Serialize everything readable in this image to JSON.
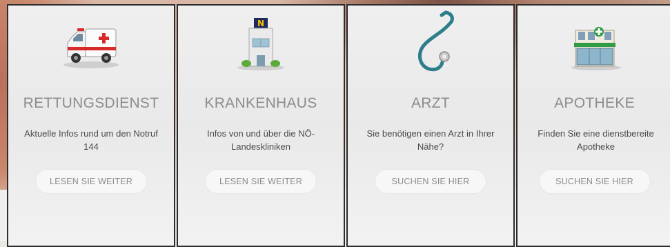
{
  "cards": [
    {
      "icon": "ambulance-icon",
      "title": "RETTUNGSDIENST",
      "description": "Aktuelle Infos rund um den Notruf 144",
      "button": "LESEN SIE WEITER"
    },
    {
      "icon": "hospital-icon",
      "title": "KRANKENHAUS",
      "description": "Infos von und über die NÖ-Landeskliniken",
      "button": "LESEN SIE WEITER"
    },
    {
      "icon": "stethoscope-icon",
      "title": "ARZT",
      "description": "Sie benötigen einen Arzt in Ihrer Nähe?",
      "button": "SUCHEN SIE HIER"
    },
    {
      "icon": "pharmacy-icon",
      "title": "APOTHEKE",
      "description": "Finden Sie eine dienstbereite Apotheke",
      "button": "SUCHEN SIE HIER"
    }
  ],
  "hospital_sign_letter": "N",
  "colors": {
    "card_border": "#2c2c2c",
    "title": "#8c8c8c",
    "description": "#4b4b4b",
    "button_text": "#8a8a8a",
    "stethoscope": "#2d7d8a"
  }
}
